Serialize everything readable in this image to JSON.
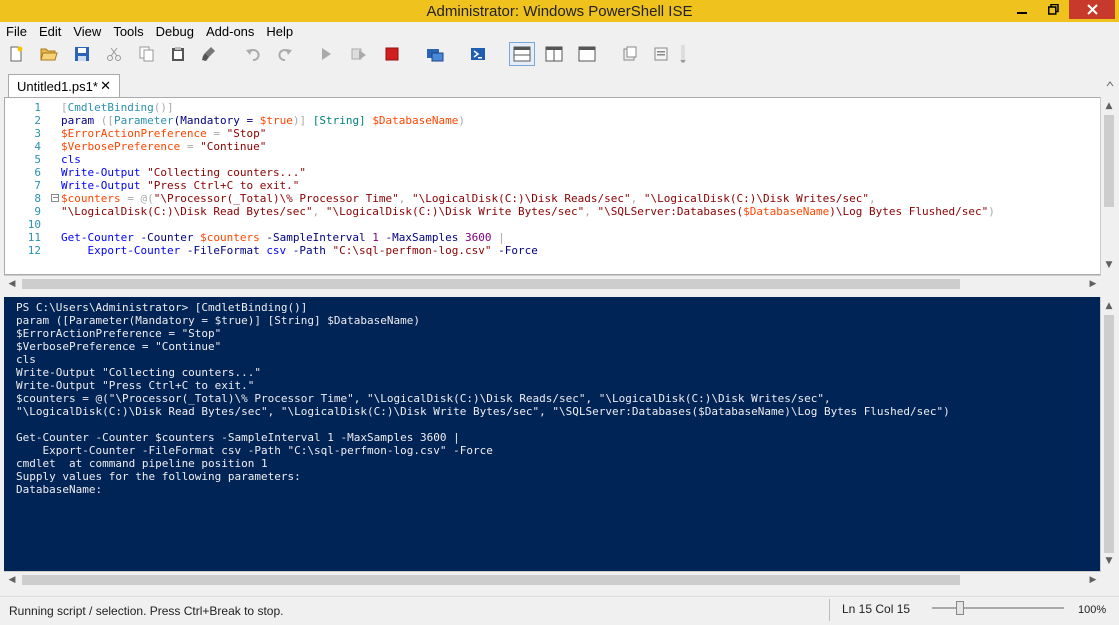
{
  "window": {
    "title": "Administrator: Windows PowerShell ISE"
  },
  "menu": [
    "File",
    "Edit",
    "View",
    "Tools",
    "Debug",
    "Add-ons",
    "Help"
  ],
  "tab": {
    "label": "Untitled1.ps1*",
    "close": "✕"
  },
  "editor": {
    "line_numbers": [
      "1",
      "2",
      "3",
      "4",
      "5",
      "6",
      "7",
      "8",
      "9",
      "10",
      "11",
      "12"
    ],
    "code": [
      [
        {
          "t": "[",
          "c": "op"
        },
        {
          "t": "CmdletBinding",
          "c": "attr"
        },
        {
          "t": "()]",
          "c": "op"
        }
      ],
      [
        {
          "t": "param ",
          "c": "kw"
        },
        {
          "t": "([",
          "c": "op"
        },
        {
          "t": "Parameter",
          "c": "attr"
        },
        {
          "t": "(Mandatory = ",
          "c": "param"
        },
        {
          "t": "$true",
          "c": "var"
        },
        {
          "t": ")] ",
          "c": "op"
        },
        {
          "t": "[String]",
          "c": "type"
        },
        {
          "t": " ",
          "c": "op"
        },
        {
          "t": "$DatabaseName",
          "c": "var"
        },
        {
          "t": ")",
          "c": "op"
        }
      ],
      [
        {
          "t": "$ErrorActionPreference",
          "c": "var"
        },
        {
          "t": " = ",
          "c": "op"
        },
        {
          "t": "\"Stop\"",
          "c": "str"
        }
      ],
      [
        {
          "t": "$VerbosePreference",
          "c": "var"
        },
        {
          "t": " = ",
          "c": "op"
        },
        {
          "t": "\"Continue\"",
          "c": "str"
        }
      ],
      [
        {
          "t": "cls",
          "c": "cmd"
        }
      ],
      [
        {
          "t": "Write-Output",
          "c": "cmd"
        },
        {
          "t": " ",
          "c": "op"
        },
        {
          "t": "\"Collecting counters...\"",
          "c": "str"
        }
      ],
      [
        {
          "t": "Write-Output",
          "c": "cmd"
        },
        {
          "t": " ",
          "c": "op"
        },
        {
          "t": "\"Press Ctrl+C to exit.\"",
          "c": "str"
        }
      ],
      [
        {
          "t": "$counters",
          "c": "var"
        },
        {
          "t": " = @(",
          "c": "op"
        },
        {
          "t": "\"\\Processor(_Total)\\% Processor Time\"",
          "c": "str"
        },
        {
          "t": ", ",
          "c": "op"
        },
        {
          "t": "\"\\LogicalDisk(C:)\\Disk Reads/sec\"",
          "c": "str"
        },
        {
          "t": ", ",
          "c": "op"
        },
        {
          "t": "\"\\LogicalDisk(C:)\\Disk Writes/sec\"",
          "c": "str"
        },
        {
          "t": ",",
          "c": "op"
        }
      ],
      [
        {
          "t": "\"\\LogicalDisk(C:)\\Disk Read Bytes/sec\"",
          "c": "str"
        },
        {
          "t": ", ",
          "c": "op"
        },
        {
          "t": "\"\\LogicalDisk(C:)\\Disk Write Bytes/sec\"",
          "c": "str"
        },
        {
          "t": ", ",
          "c": "op"
        },
        {
          "t": "\"\\SQLServer:Databases(",
          "c": "str"
        },
        {
          "t": "$DatabaseName",
          "c": "var"
        },
        {
          "t": ")\\Log Bytes Flushed/sec\"",
          "c": "str"
        },
        {
          "t": ")",
          "c": "op"
        }
      ],
      [],
      [
        {
          "t": "Get-Counter",
          "c": "cmd"
        },
        {
          "t": " -Counter ",
          "c": "param"
        },
        {
          "t": "$counters",
          "c": "var"
        },
        {
          "t": " -SampleInterval ",
          "c": "param"
        },
        {
          "t": "1",
          "c": "num"
        },
        {
          "t": " -MaxSamples ",
          "c": "param"
        },
        {
          "t": "3600",
          "c": "num"
        },
        {
          "t": " |",
          "c": "op"
        }
      ],
      [
        {
          "t": "    ",
          "c": "op"
        },
        {
          "t": "Export-Counter",
          "c": "cmd"
        },
        {
          "t": " -FileFormat ",
          "c": "param"
        },
        {
          "t": "csv",
          "c": "cmd"
        },
        {
          "t": " -Path ",
          "c": "param"
        },
        {
          "t": "\"C:\\sql-perfmon-log.csv\"",
          "c": "str"
        },
        {
          "t": " -Force",
          "c": "param"
        }
      ]
    ],
    "fold_marker": "−"
  },
  "console": {
    "lines": [
      "PS C:\\Users\\Administrator> [CmdletBinding()]",
      "param ([Parameter(Mandatory = $true)] [String] $DatabaseName)",
      "$ErrorActionPreference = \"Stop\"",
      "$VerbosePreference = \"Continue\"",
      "cls",
      "Write-Output \"Collecting counters...\"",
      "Write-Output \"Press Ctrl+C to exit.\"",
      "$counters = @(\"\\Processor(_Total)\\% Processor Time\", \"\\LogicalDisk(C:)\\Disk Reads/sec\", \"\\LogicalDisk(C:)\\Disk Writes/sec\",",
      "\"\\LogicalDisk(C:)\\Disk Read Bytes/sec\", \"\\LogicalDisk(C:)\\Disk Write Bytes/sec\", \"\\SQLServer:Databases($DatabaseName)\\Log Bytes Flushed/sec\")",
      "",
      "Get-Counter -Counter $counters -SampleInterval 1 -MaxSamples 3600 |",
      "    Export-Counter -FileFormat csv -Path \"C:\\sql-perfmon-log.csv\" -Force",
      "cmdlet  at command pipeline position 1",
      "Supply values for the following parameters:",
      "DatabaseName:"
    ]
  },
  "status": {
    "message": "Running script / selection.  Press Ctrl+Break to stop.",
    "position": "Ln 15  Col 15",
    "zoom": "100%",
    "zoom_level_percent": 100
  },
  "colors": {
    "titlebar": "#efc21d",
    "console_bg": "#012456",
    "close_button": "#c7392a"
  }
}
